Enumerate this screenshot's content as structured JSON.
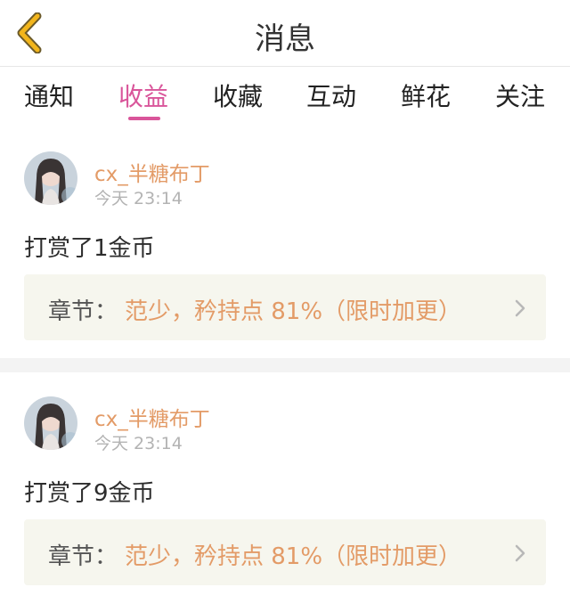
{
  "header": {
    "title": "消息",
    "back_icon": "chevron-left-icon",
    "back_color": "#f2b51c"
  },
  "tabs": [
    {
      "label": "通知",
      "active": false
    },
    {
      "label": "收益",
      "active": true
    },
    {
      "label": "收藏",
      "active": false
    },
    {
      "label": "互动",
      "active": false
    },
    {
      "label": "鲜花",
      "active": false
    },
    {
      "label": "关注",
      "active": false
    }
  ],
  "colors": {
    "accent": "#d9559a",
    "username": "#e39b67",
    "chapter_box_bg": "#f6f6ee"
  },
  "messages": [
    {
      "username": "cx_半糖布丁",
      "time": "今天 23:14",
      "content": "打赏了1金币",
      "chapter_label": "章节：",
      "chapter_name": "范少，矜持点 81%（限时加更）"
    },
    {
      "username": "cx_半糖布丁",
      "time": "今天 23:14",
      "content": "打赏了9金币",
      "chapter_label": "章节：",
      "chapter_name": "范少，矜持点 81%（限时加更）"
    }
  ]
}
